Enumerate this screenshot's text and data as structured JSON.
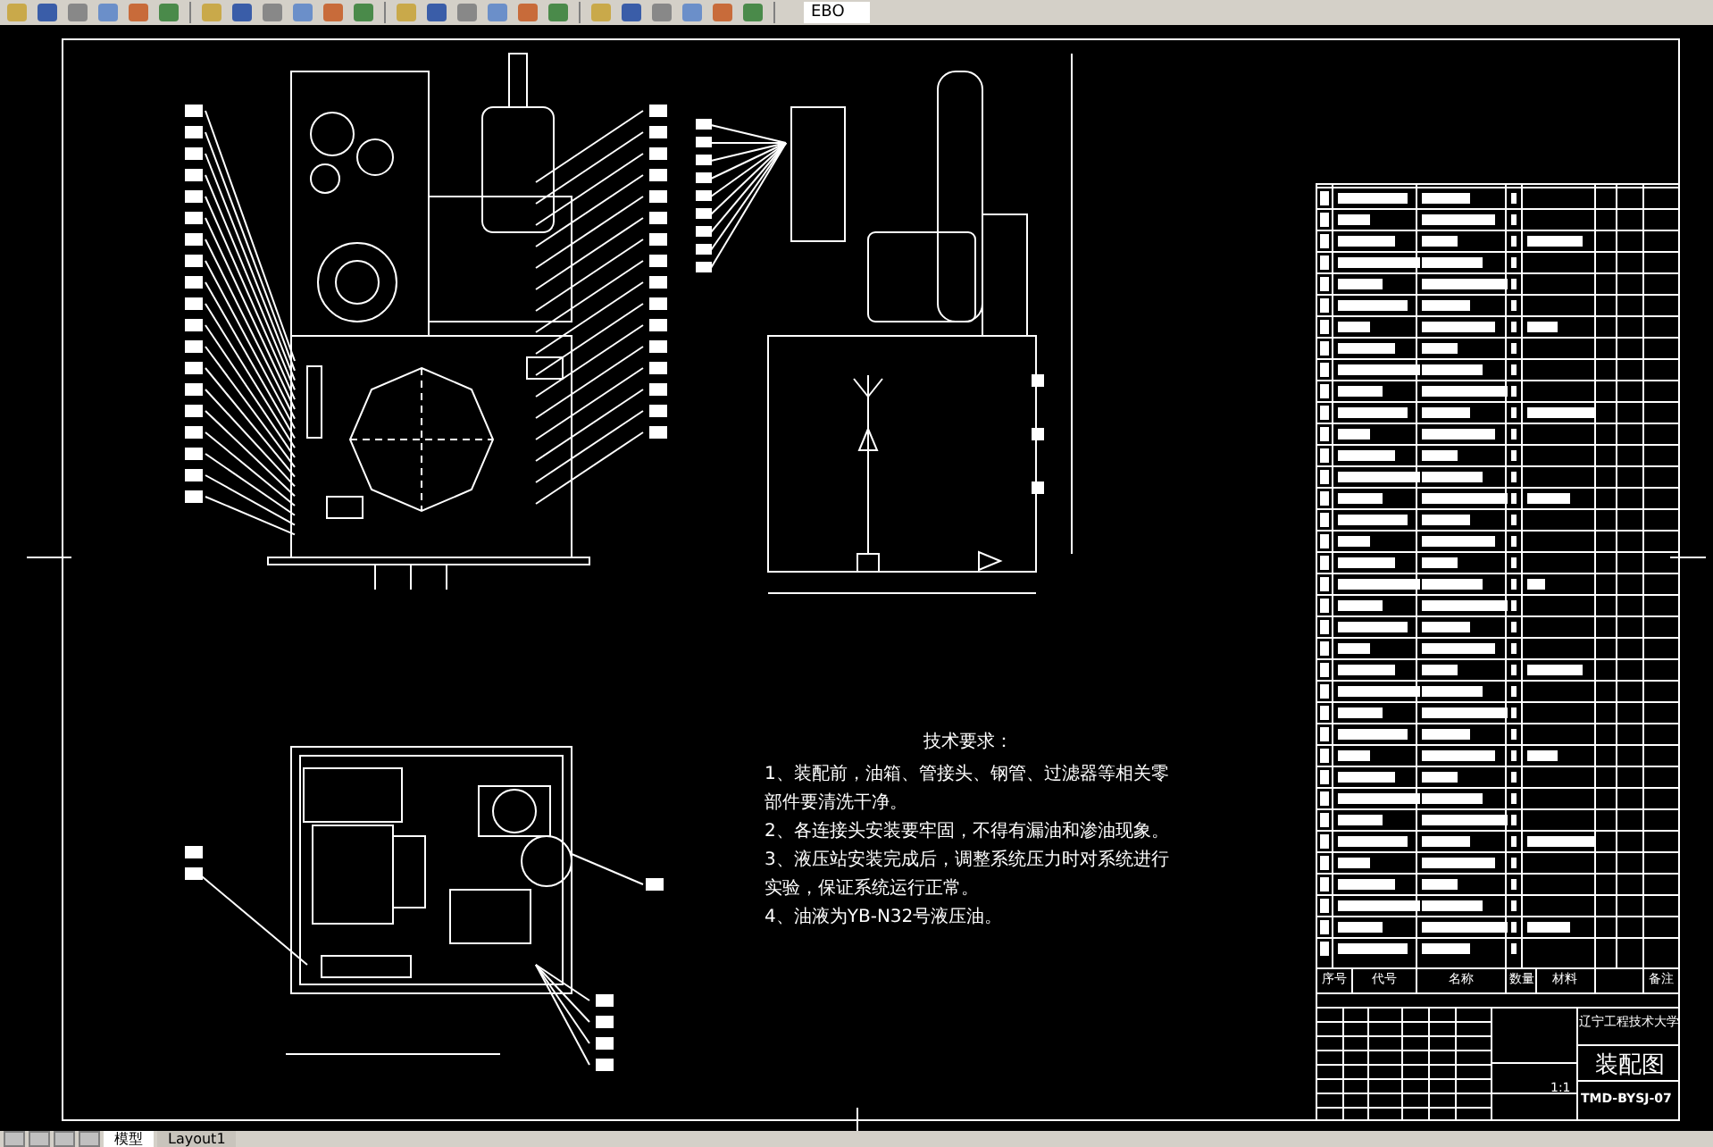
{
  "toolbar": {
    "layer_name": "EBO"
  },
  "tech_requirements": {
    "title": "技术要求：",
    "items": [
      "1、装配前，油箱、管接头、钢管、过滤器等相关零部件要清洗干净。",
      "2、各连接头安装要牢固，不得有漏油和渗油现象。",
      "3、液压站安装完成后，调整系统压力时对系统进行实验，保证系统运行正常。",
      "4、油液为YB-N32号液压油。"
    ]
  },
  "title_block": {
    "headers": [
      "序号",
      "代号",
      "名称",
      "数量",
      "材料",
      "备注"
    ],
    "school": "辽宁工程技术大学",
    "drawing_title": "装配图",
    "drawing_number": "TMD-BYSJ-07",
    "scale": "1:1"
  },
  "layout_tabs": [
    {
      "label": "模型",
      "selected": true
    },
    {
      "label": "Layout1",
      "selected": false
    }
  ]
}
